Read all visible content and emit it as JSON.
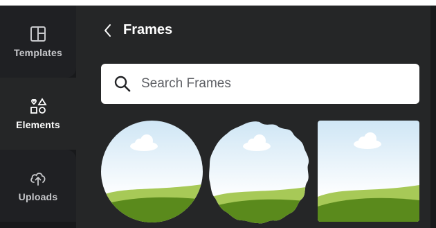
{
  "rail": {
    "items": [
      {
        "label": "Templates",
        "icon": "templates-icon"
      },
      {
        "label": "Elements",
        "icon": "elements-icon",
        "active": true
      },
      {
        "label": "Uploads",
        "icon": "upload-cloud-icon"
      }
    ]
  },
  "panel": {
    "title": "Frames",
    "back_icon": "chevron-left-icon",
    "search": {
      "placeholder": "Search Frames",
      "value": "",
      "icon": "search-icon"
    },
    "frames": [
      {
        "shape": "circle"
      },
      {
        "shape": "wavy-circle"
      },
      {
        "shape": "rounded-square"
      }
    ]
  },
  "colors": {
    "rail_bg": "#18191b",
    "panel_bg": "#252627",
    "sky_top": "#cfe6f5",
    "sky_bottom": "#ffffff",
    "hill_light": "#a7c957",
    "hill_dark": "#5a8a1c"
  }
}
